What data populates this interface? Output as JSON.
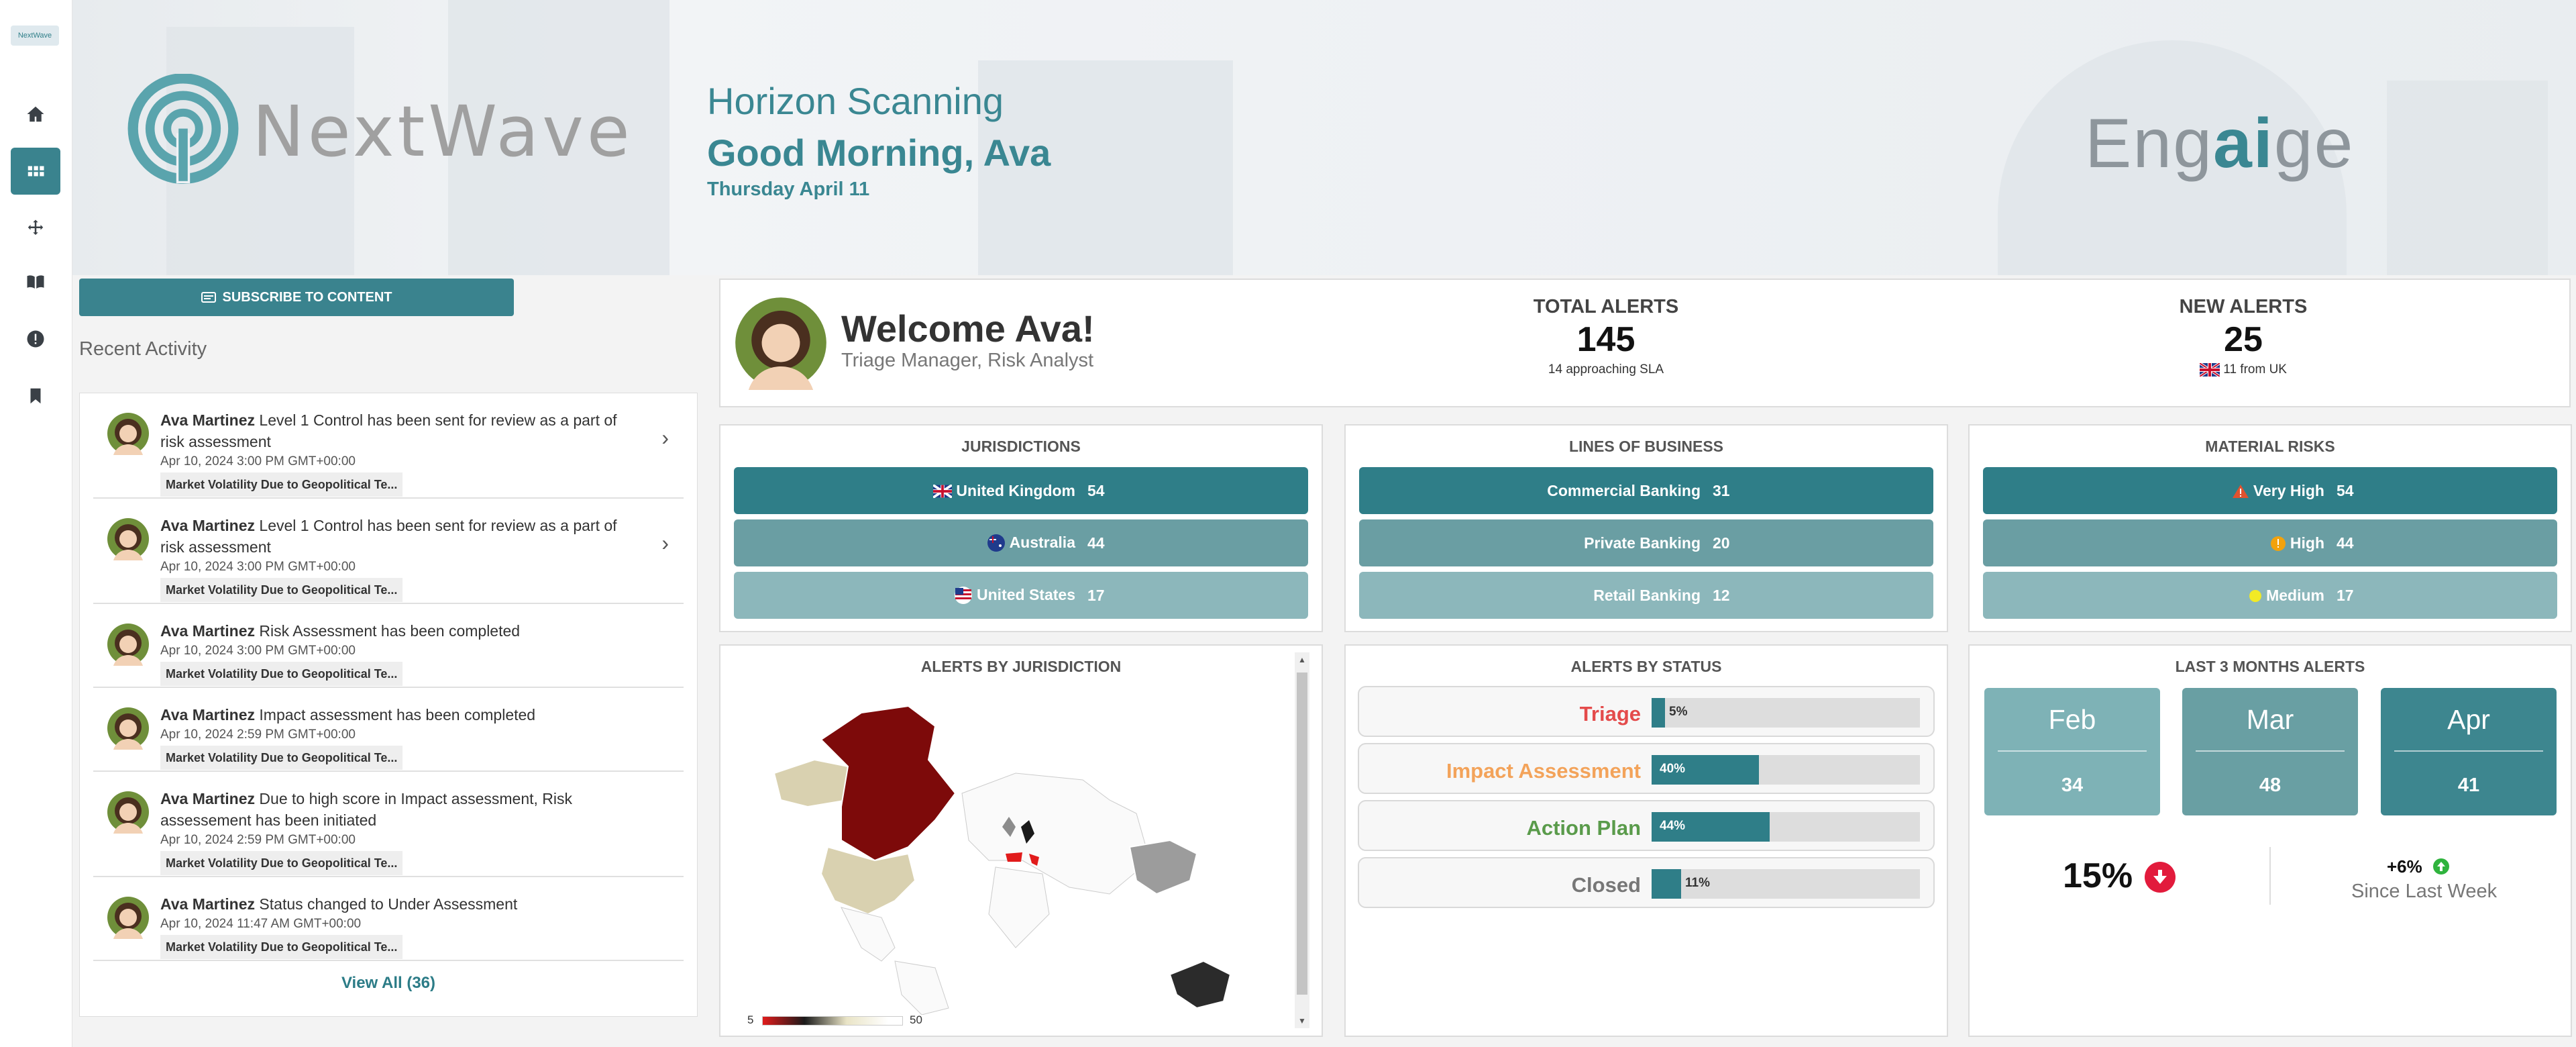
{
  "rail": {
    "logo_text": "NextWave",
    "items": [
      "home-icon",
      "dashboard-icon",
      "move-icon",
      "book-icon",
      "alert-icon",
      "bookmark-icon"
    ],
    "active_index": 1
  },
  "banner": {
    "brand": "NextWave",
    "section_title": "Horizon Scanning",
    "greeting": "Good Morning, Ava",
    "date": "Thursday April 11",
    "product_prefix": "Eng",
    "product_ai": "ai",
    "product_suffix": "ge"
  },
  "activity": {
    "subscribe_label": "SUBSCRIBE TO CONTENT",
    "title": "Recent Activity",
    "items": [
      {
        "who": "Ava Martinez",
        "text": " Level 1 Control  has been sent for review as a part of risk assessment",
        "when": "Apr 10, 2024 3:00 PM GMT+00:00",
        "tag": "Market Volatility Due to Geopolitical Te...",
        "chevron": "›"
      },
      {
        "who": "Ava Martinez",
        "text": " Level 1 Control  has been sent for review as a part of risk assessment",
        "when": "Apr 10, 2024 3:00 PM GMT+00:00",
        "tag": "Market Volatility Due to Geopolitical Te...",
        "chevron": "›"
      },
      {
        "who": "Ava Martinez",
        "text": " Risk Assessment has been completed",
        "when": "Apr 10, 2024 3:00 PM GMT+00:00",
        "tag": "Market Volatility Due to Geopolitical Te..."
      },
      {
        "who": "Ava Martinez",
        "text": " Impact assessment has been completed",
        "when": "Apr 10, 2024 2:59 PM GMT+00:00",
        "tag": "Market Volatility Due to Geopolitical Te..."
      },
      {
        "who": "Ava Martinez",
        "text": " Due to high score in Impact assessment, Risk assessement has been initiated",
        "when": "Apr 10, 2024 2:59 PM GMT+00:00",
        "tag": "Market Volatility Due to Geopolitical Te..."
      },
      {
        "who": "Ava Martinez",
        "text": " Status changed to Under Assessment",
        "when": "Apr 10, 2024 11:47 AM GMT+00:00",
        "tag": "Market Volatility Due to Geopolitical Te..."
      }
    ],
    "view_all": "View All (36)"
  },
  "welcome": {
    "title": "Welcome Ava!",
    "role": "Triage Manager, Risk Analyst"
  },
  "kpis": {
    "total": {
      "label": "TOTAL ALERTS",
      "value": "145",
      "sub": "14 approaching SLA"
    },
    "new": {
      "label": "NEW ALERTS",
      "value": "25",
      "sub": "11 from UK"
    }
  },
  "jurisdictions": {
    "title": "JURISDICTIONS",
    "rows": [
      {
        "label": "United Kingdom",
        "value": "54",
        "flag": "uk-flag-icon"
      },
      {
        "label": "Australia",
        "value": "44",
        "flag": "australia-flag-icon"
      },
      {
        "label": "United States",
        "value": "17",
        "flag": "us-flag-icon"
      }
    ]
  },
  "lines_of_business": {
    "title": "LINES OF BUSINESS",
    "rows": [
      {
        "label": "Commercial Banking",
        "value": "31"
      },
      {
        "label": "Private Banking",
        "value": "20"
      },
      {
        "label": "Retail Banking",
        "value": "12"
      }
    ]
  },
  "material_risks": {
    "title": "MATERIAL RISKS",
    "rows": [
      {
        "label": "Very High",
        "value": "54",
        "icon": "warning-icon",
        "color": "#e0522f"
      },
      {
        "label": "High",
        "value": "44",
        "icon": "exclamation-icon",
        "color": "#f2a20c"
      },
      {
        "label": "Medium",
        "value": "17",
        "icon": "dot-icon",
        "color": "#f2ea25"
      }
    ]
  },
  "map": {
    "title": "ALERTS BY JURISDICTION",
    "legend_min": "5",
    "legend_max": "50"
  },
  "status": {
    "title": "ALERTS BY STATUS",
    "rows": [
      {
        "label": "Triage",
        "pct": "5%",
        "value": 5,
        "color": "#e44b4b"
      },
      {
        "label": "Impact Assessment",
        "pct": "40%",
        "value": 40,
        "color": "#f3a35a"
      },
      {
        "label": "Action Plan",
        "pct": "44%",
        "value": 44,
        "color": "#5a9b4b"
      },
      {
        "label": "Closed",
        "pct": "11%",
        "value": 11,
        "color": "#777777"
      }
    ]
  },
  "months": {
    "title": "LAST 3 MONTHS ALERTS",
    "items": [
      {
        "month": "Feb",
        "count": "34",
        "color": "#7eb2b6"
      },
      {
        "month": "Mar",
        "count": "48",
        "color": "#699fa3"
      },
      {
        "month": "Apr",
        "count": "41",
        "color": "#3d868f"
      }
    ],
    "change_pct": "15%",
    "weekly_change": "+6%",
    "weekly_label": "Since Last Week"
  }
}
